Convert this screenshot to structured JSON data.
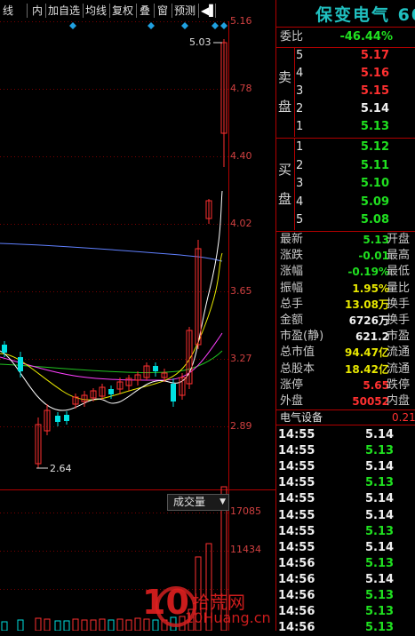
{
  "toolbar": {
    "items": [
      "线",
      "内",
      "加自选",
      "均线",
      "复权",
      "叠",
      "窗",
      "预测",
      "◀▌"
    ]
  },
  "chart": {
    "price_ticks": [
      "5.16",
      "4.78",
      "4.40",
      "4.02",
      "3.65",
      "3.27",
      "2.89"
    ],
    "high_label": "5.03",
    "low_label": "2.64",
    "volume_button": "成交量",
    "volume_ticks": [
      "17085",
      "11434"
    ],
    "colors": {
      "up": "#ff3030",
      "down": "#00e0e0",
      "ma5": "#ffffff",
      "ma10": "#e8e800",
      "ma20": "#ff40ff",
      "ma60": "#20c020",
      "ma120": "#6080ff"
    }
  },
  "panel": {
    "title": "保变电气 60",
    "weibi_label": "委比",
    "weibi_value": "-46.44%",
    "sell_label_1": "卖",
    "sell_label_2": "盘",
    "buy_label_1": "买",
    "buy_label_2": "盘",
    "sell": [
      {
        "n": "5",
        "price": "5.17"
      },
      {
        "n": "4",
        "price": "5.16"
      },
      {
        "n": "3",
        "price": "5.15"
      },
      {
        "n": "2",
        "price": "5.14"
      },
      {
        "n": "1",
        "price": "5.13"
      }
    ],
    "buy": [
      {
        "n": "1",
        "price": "5.12"
      },
      {
        "n": "2",
        "price": "5.11"
      },
      {
        "n": "3",
        "price": "5.10"
      },
      {
        "n": "4",
        "price": "5.09"
      },
      {
        "n": "5",
        "price": "5.08"
      }
    ],
    "stats": [
      {
        "label": "最新",
        "value": "5.13",
        "label2": "开盘"
      },
      {
        "label": "涨跌",
        "value": "-0.01",
        "label2": "最高"
      },
      {
        "label": "涨幅",
        "value": "-0.19%",
        "label2": "最低"
      },
      {
        "label": "振幅",
        "value": "1.95%",
        "label2": "量比"
      },
      {
        "label": "总手",
        "value": "13.08万",
        "label2": "换手"
      },
      {
        "label": "金额",
        "value": "6726万",
        "label2": "换手"
      },
      {
        "label": "市盈(静)",
        "value": "621.2",
        "label2": "市盈"
      },
      {
        "label": "总市值",
        "value": "94.47亿",
        "label2": "流通"
      },
      {
        "label": "总股本",
        "value": "18.42亿",
        "label2": "流通"
      },
      {
        "label": "涨停",
        "value": "5.65",
        "label2": "跌停"
      },
      {
        "label": "外盘",
        "value": "50052",
        "label2": "内盘"
      }
    ],
    "sector_label": "电气设备",
    "sector_value": "0.21",
    "trades": [
      {
        "time": "14:55",
        "price": "5.14",
        "color": "white"
      },
      {
        "time": "14:55",
        "price": "5.13",
        "color": "green"
      },
      {
        "time": "14:55",
        "price": "5.14",
        "color": "white"
      },
      {
        "time": "14:55",
        "price": "5.13",
        "color": "green"
      },
      {
        "time": "14:55",
        "price": "5.14",
        "color": "white"
      },
      {
        "time": "14:55",
        "price": "5.14",
        "color": "white"
      },
      {
        "time": "14:55",
        "price": "5.13",
        "color": "green"
      },
      {
        "time": "14:55",
        "price": "5.14",
        "color": "white"
      },
      {
        "time": "14:56",
        "price": "5.13",
        "color": "green"
      },
      {
        "time": "14:56",
        "price": "5.14",
        "color": "white"
      },
      {
        "time": "14:56",
        "price": "5.13",
        "color": "green"
      },
      {
        "time": "14:56",
        "price": "5.13",
        "color": "green"
      },
      {
        "time": "14:56",
        "price": "5.13",
        "color": "green"
      }
    ]
  },
  "watermark": {
    "brand_num": "10",
    "brand_cn": "拾荒网",
    "brand_url": "10Huang.cn"
  }
}
